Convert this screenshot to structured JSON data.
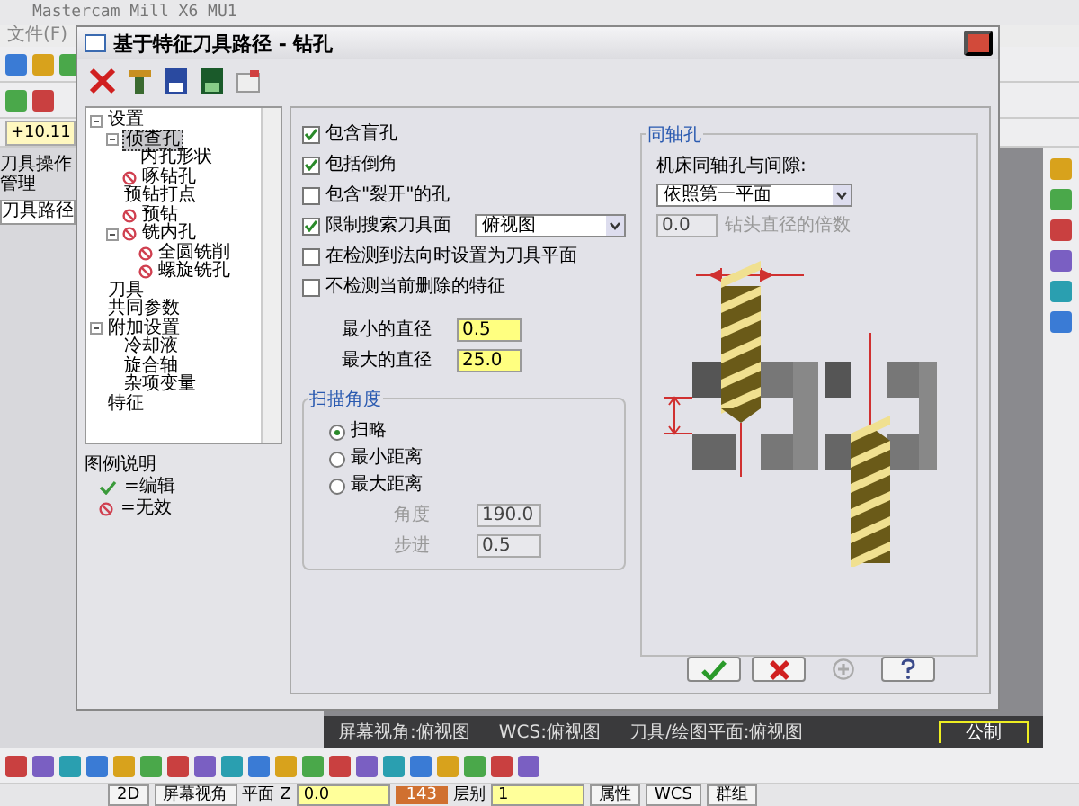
{
  "app": {
    "title": "Mastercam Mill X6 MU1",
    "menu": [
      "文件(F)"
    ],
    "coordinate": "+10.11",
    "manager_title": "刀具操作管理",
    "manager_tab": "刀具路径",
    "status": [
      "屏幕视角:俯视图",
      "WCS:俯视图",
      "刀具/绘图平面:俯视图"
    ],
    "scale_label": "公制",
    "bottom_bar": [
      {
        "kind": "button",
        "text": "2D"
      },
      {
        "kind": "button",
        "text": "屏幕视角"
      },
      {
        "kind": "label",
        "text": "平面"
      },
      {
        "kind": "label",
        "text": "Z"
      },
      {
        "kind": "field",
        "text": "0.0"
      },
      {
        "kind": "color_field",
        "text": "143"
      },
      {
        "kind": "label",
        "text": "层别"
      },
      {
        "kind": "field",
        "text": "1"
      },
      {
        "kind": "button",
        "text": "属性"
      },
      {
        "kind": "button",
        "text": "WCS"
      },
      {
        "kind": "button",
        "text": "群组"
      }
    ]
  },
  "dialog": {
    "title": "基于特征刀具路径 - 钻孔",
    "tree": [
      {
        "label": "设置",
        "invalid": false,
        "selected": false,
        "expanded": true,
        "children": [
          {
            "label": "侦查孔",
            "invalid": false,
            "selected": true,
            "expanded": true,
            "children": [
              {
                "label": "内孔形状",
                "invalid": false,
                "selected": false
              }
            ]
          },
          {
            "label": "啄钻孔",
            "invalid": true,
            "selected": false
          },
          {
            "label": "预钻打点",
            "invalid": false,
            "selected": false
          },
          {
            "label": "预钻",
            "invalid": true,
            "selected": false
          },
          {
            "label": "铣内孔",
            "invalid": true,
            "selected": false,
            "expanded": true,
            "children": [
              {
                "label": "全圆铣削",
                "invalid": true,
                "selected": false
              },
              {
                "label": "螺旋铣孔",
                "invalid": true,
                "selected": false
              }
            ]
          }
        ]
      },
      {
        "label": "刀具",
        "invalid": false,
        "selected": false
      },
      {
        "label": "共同参数",
        "invalid": false,
        "selected": false
      },
      {
        "label": "附加设置",
        "invalid": false,
        "selected": false,
        "expanded": true,
        "children": [
          {
            "label": "冷却液",
            "invalid": false,
            "selected": false
          },
          {
            "label": "旋合轴",
            "invalid": false,
            "selected": false
          },
          {
            "label": "杂项变量",
            "invalid": false,
            "selected": false
          }
        ]
      },
      {
        "label": "特征",
        "invalid": false,
        "selected": false
      }
    ],
    "legend": {
      "title": "图例说明",
      "items": [
        {
          "kind": "edit",
          "label": "=编辑"
        },
        {
          "kind": "invalid",
          "label": "=无效"
        }
      ]
    },
    "options": [
      {
        "label": "包含盲孔",
        "checked": true
      },
      {
        "label": "包括倒角",
        "checked": true
      },
      {
        "label": "包含\"裂开\"的孔",
        "checked": false
      },
      {
        "label": "限制搜索刀具面",
        "checked": true,
        "select": "俯视图"
      },
      {
        "label": "在检测到法向时设置为刀具平面",
        "checked": false
      },
      {
        "label": "不检测当前删除的特征",
        "checked": false
      }
    ],
    "diameters": [
      {
        "label": "最小的直径",
        "value": "0.5"
      },
      {
        "label": "最大的直径",
        "value": "25.0"
      }
    ],
    "sweep": {
      "title": "扫描角度",
      "radios": [
        {
          "label": "扫略",
          "selected": true
        },
        {
          "label": "最小距离",
          "selected": false
        },
        {
          "label": "最大距离",
          "selected": false
        }
      ],
      "fields": [
        {
          "label": "角度",
          "value": "190.0"
        },
        {
          "label": "步进",
          "value": "0.5"
        }
      ]
    },
    "coaxial": {
      "title": "同轴孔",
      "label": "机床同轴孔与间隙:",
      "select": "依照第一平面",
      "value": "0.0",
      "value_label": "钻头直径的倍数"
    },
    "buttons": [
      {
        "kind": "ok",
        "disabled": false
      },
      {
        "kind": "cancel",
        "disabled": false
      },
      {
        "kind": "add",
        "disabled": true
      },
      {
        "kind": "help",
        "disabled": false
      }
    ]
  }
}
